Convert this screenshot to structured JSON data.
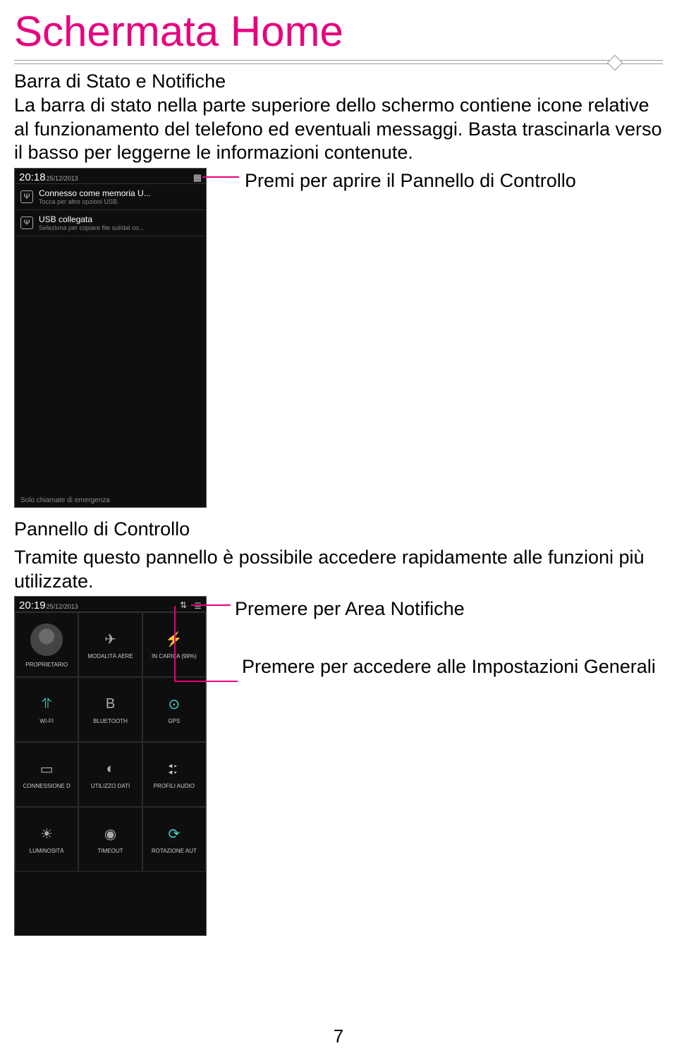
{
  "title": "Schermata Home",
  "section1": {
    "heading": "Barra di Stato e Notifiche",
    "paragraph": "La barra di stato nella parte superiore dello schermo contiene icone relative al funzionamento del telefono ed eventuali messaggi. Basta trascinarla verso il basso per leggerne le informazioni contenute."
  },
  "callout1": "Premi per aprire il Pannello di Controllo",
  "phone1": {
    "time": "20:18",
    "date": "25/12/2013",
    "tiles_icon": "tiles-icon",
    "notifications": [
      {
        "icon": "Ψ",
        "title": "Connesso come memoria U...",
        "sub": "Tocca per altre opzioni USB."
      },
      {
        "icon": "Ψ",
        "title": "USB collegata",
        "sub": "Seleziona per copiare file sul/dal co..."
      }
    ],
    "footer": "Solo chiamate di emergenza"
  },
  "section2": {
    "heading": "Pannello di Controllo",
    "paragraph": "Tramite questo pannello è possibile accedere rapidamente alle funzioni più utilizzate."
  },
  "callout2a": "Premere per Area Notifiche",
  "callout2b": "Premere per accedere alle Impostazioni Generali",
  "phone2": {
    "time": "20:19",
    "date": "25/12/2013",
    "icons": {
      "settings": "⚙",
      "list": "≣"
    },
    "tiles": [
      {
        "icon_type": "owner",
        "label": "PROPRIETARIO"
      },
      {
        "icon": "✈",
        "label": "MODALITÀ AERE"
      },
      {
        "icon": "⚡",
        "label": "IN CARICA (99%)",
        "accent": true
      },
      {
        "icon": "⥣",
        "label": "WI-FI",
        "accent": true
      },
      {
        "icon": "В",
        "label": "BLUETOOTH"
      },
      {
        "icon": "⊙",
        "label": "GPS",
        "accent": true
      },
      {
        "icon": "▭",
        "label": "CONNESSIONE D"
      },
      {
        "icon": "◐",
        "label": "UTILIZZO DATI"
      },
      {
        "icon_type": "sliders",
        "label": "PROFILI AUDIO"
      },
      {
        "icon": "☀",
        "label": "LUMINOSITÀ"
      },
      {
        "icon": "◉",
        "label": "TIMEOUT"
      },
      {
        "icon": "⟳",
        "label": "ROTAZIONE AUT",
        "accent": true
      }
    ]
  },
  "page_number": "7",
  "colors": {
    "accent": "#e6007e",
    "teal": "#3dd6c4"
  }
}
